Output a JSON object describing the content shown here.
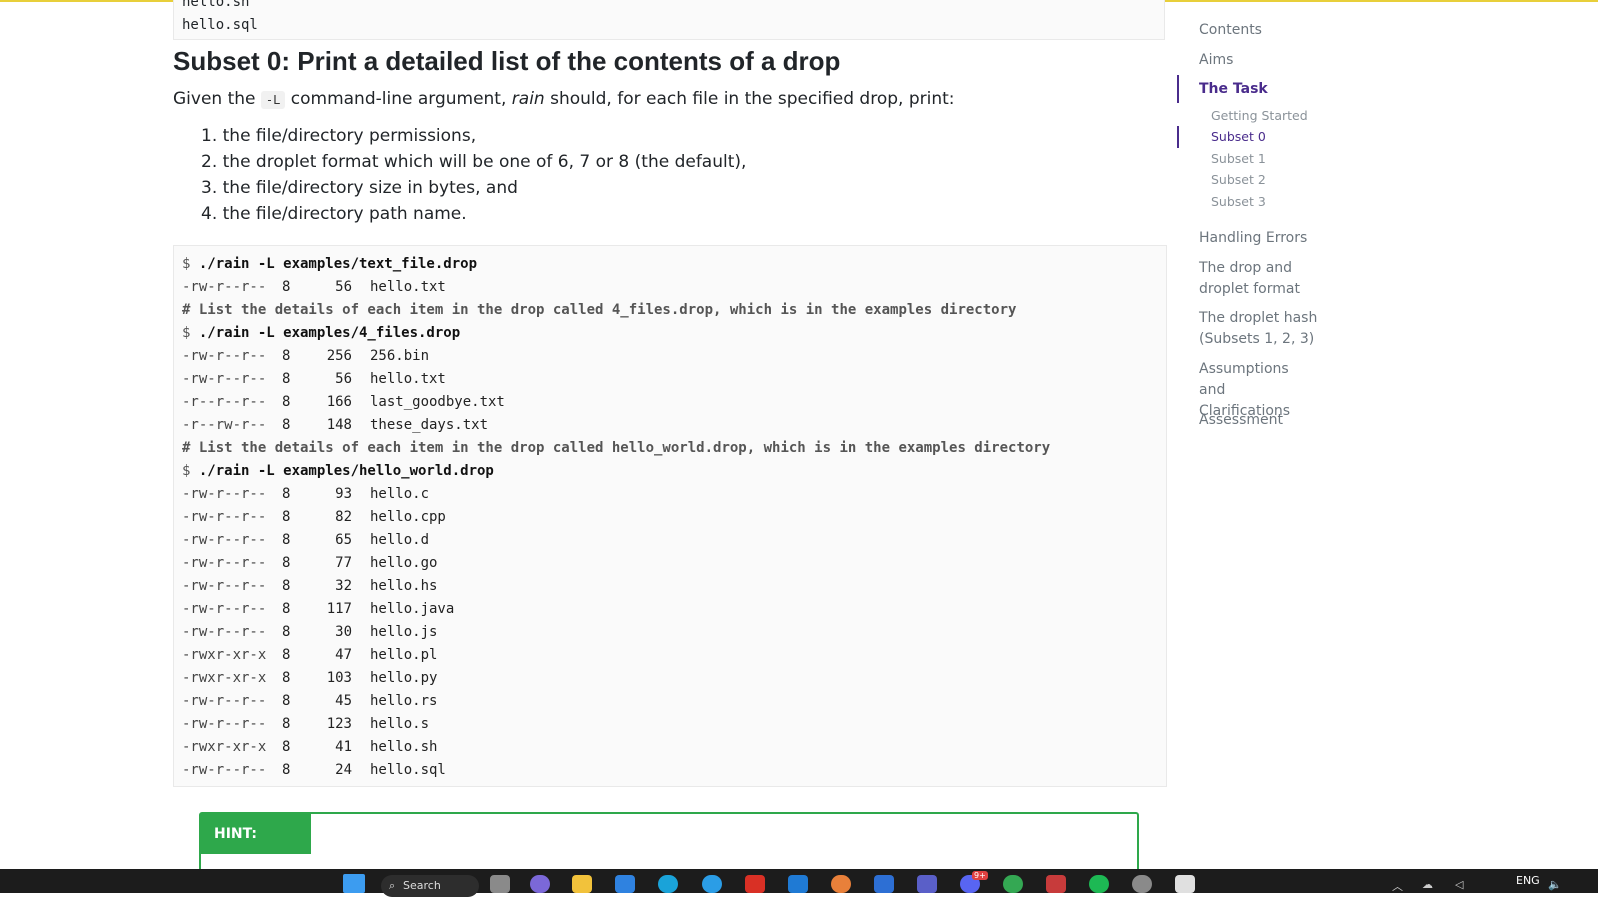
{
  "code_top": {
    "lines": [
      "hello.sh",
      "hello.sql"
    ]
  },
  "heading": "Subset 0: Print a detailed list of the contents of a drop",
  "intro": {
    "before": "Given the ",
    "flag": "-L",
    "middle": " command-line argument, ",
    "program": "rain",
    "after": " should, for each file in the specified drop, print:"
  },
  "list": [
    "1. the file/directory permissions,",
    "2. the droplet format which will be one of 6, 7 or 8 (the default),",
    "3. the file/directory size in bytes, and",
    "4. the file/directory path name."
  ],
  "code": {
    "prompt": "$",
    "lines": [
      {
        "type": "cmd",
        "text": "./rain -L examples/text_file.drop"
      },
      {
        "type": "entry",
        "perm": "-rw-r--r--",
        "fmt": "8",
        "size": "56",
        "name": "hello.txt"
      },
      {
        "type": "comment",
        "text": "# List the details of each item in the drop called 4_files.drop, which is in the examples directory"
      },
      {
        "type": "cmd",
        "text": "./rain -L examples/4_files.drop"
      },
      {
        "type": "entry",
        "perm": "-rw-r--r--",
        "fmt": "8",
        "size": "256",
        "name": "256.bin"
      },
      {
        "type": "entry",
        "perm": "-rw-r--r--",
        "fmt": "8",
        "size": "56",
        "name": "hello.txt"
      },
      {
        "type": "entry",
        "perm": "-r--r--r--",
        "fmt": "8",
        "size": "166",
        "name": "last_goodbye.txt"
      },
      {
        "type": "entry",
        "perm": "-r--rw-r--",
        "fmt": "8",
        "size": "148",
        "name": "these_days.txt"
      },
      {
        "type": "comment",
        "text": "# List the details of each item in the drop called hello_world.drop, which is in the examples directory"
      },
      {
        "type": "cmd",
        "text": "./rain -L examples/hello_world.drop"
      },
      {
        "type": "entry",
        "perm": "-rw-r--r--",
        "fmt": "8",
        "size": "93",
        "name": "hello.c"
      },
      {
        "type": "entry",
        "perm": "-rw-r--r--",
        "fmt": "8",
        "size": "82",
        "name": "hello.cpp"
      },
      {
        "type": "entry",
        "perm": "-rw-r--r--",
        "fmt": "8",
        "size": "65",
        "name": "hello.d"
      },
      {
        "type": "entry",
        "perm": "-rw-r--r--",
        "fmt": "8",
        "size": "77",
        "name": "hello.go"
      },
      {
        "type": "entry",
        "perm": "-rw-r--r--",
        "fmt": "8",
        "size": "32",
        "name": "hello.hs"
      },
      {
        "type": "entry",
        "perm": "-rw-r--r--",
        "fmt": "8",
        "size": "117",
        "name": "hello.java"
      },
      {
        "type": "entry",
        "perm": "-rw-r--r--",
        "fmt": "8",
        "size": "30",
        "name": "hello.js"
      },
      {
        "type": "entry",
        "perm": "-rwxr-xr-x",
        "fmt": "8",
        "size": "47",
        "name": "hello.pl"
      },
      {
        "type": "entry",
        "perm": "-rwxr-xr-x",
        "fmt": "8",
        "size": "103",
        "name": "hello.py"
      },
      {
        "type": "entry",
        "perm": "-rw-r--r--",
        "fmt": "8",
        "size": "45",
        "name": "hello.rs"
      },
      {
        "type": "entry",
        "perm": "-rw-r--r--",
        "fmt": "8",
        "size": "123",
        "name": "hello.s"
      },
      {
        "type": "entry",
        "perm": "-rwxr-xr-x",
        "fmt": "8",
        "size": "41",
        "name": "hello.sh"
      },
      {
        "type": "entry",
        "perm": "-rw-r--r--",
        "fmt": "8",
        "size": "24",
        "name": "hello.sql"
      }
    ]
  },
  "hint": {
    "label": "HINT:"
  },
  "toc": {
    "contents": "Contents",
    "aims": "Aims",
    "the_task": "The Task",
    "getting_started": "Getting Started",
    "subset0": "Subset 0",
    "subset1": "Subset 1",
    "subset2": "Subset 2",
    "subset3": "Subset 3",
    "handling_errors": "Handling Errors",
    "drop_format": "The drop and droplet format",
    "droplet_hash": "The droplet hash (Subsets 1, 2, 3)",
    "assumptions": "Assumptions and Clarifications",
    "assessment": "Assessment",
    "active_color": "#4a2c8c"
  },
  "taskbar": {
    "search_label": "Search",
    "lang": "ENG",
    "badge": "9+"
  }
}
